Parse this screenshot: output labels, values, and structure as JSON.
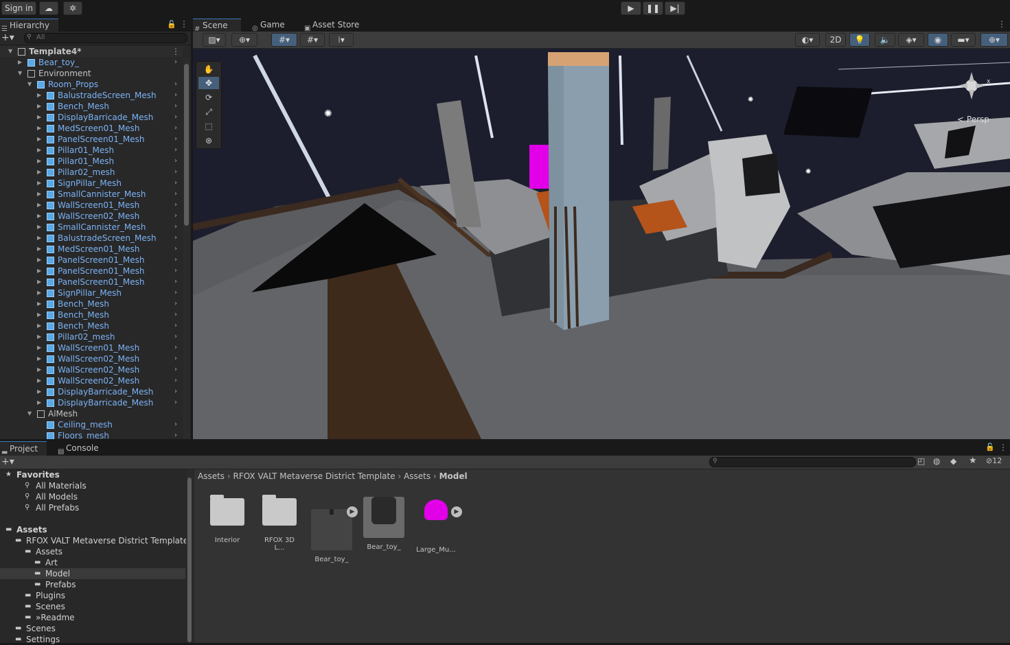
{
  "topbar": {
    "signin": "Sign in"
  },
  "hierarchy": {
    "tab": "Hierarchy",
    "search_placeholder": "All",
    "rows": [
      {
        "label": "Template4*",
        "depth": 0,
        "blue": false
      },
      {
        "label": "Bear_toy_",
        "depth": 1,
        "blue": true
      },
      {
        "label": "Environment",
        "depth": 1,
        "blue": false
      },
      {
        "label": "Room_Props",
        "depth": 2,
        "blue": true
      },
      {
        "label": "BalustradeScreen_Mesh",
        "depth": 3,
        "blue": true
      },
      {
        "label": "Bench_Mesh",
        "depth": 3,
        "blue": true
      },
      {
        "label": "DisplayBarricade_Mesh",
        "depth": 3,
        "blue": true
      },
      {
        "label": "MedScreen01_Mesh",
        "depth": 3,
        "blue": true
      },
      {
        "label": "PanelScreen01_Mesh",
        "depth": 3,
        "blue": true
      },
      {
        "label": "Pillar01_Mesh",
        "depth": 3,
        "blue": true
      },
      {
        "label": "Pillar01_Mesh",
        "depth": 3,
        "blue": true
      },
      {
        "label": "Pillar02_mesh",
        "depth": 3,
        "blue": true
      },
      {
        "label": "SignPillar_Mesh",
        "depth": 3,
        "blue": true
      },
      {
        "label": "SmallCannister_Mesh",
        "depth": 3,
        "blue": true
      },
      {
        "label": "WallScreen01_Mesh",
        "depth": 3,
        "blue": true
      },
      {
        "label": "WallScreen02_Mesh",
        "depth": 3,
        "blue": true
      },
      {
        "label": "SmallCannister_Mesh",
        "depth": 3,
        "blue": true
      },
      {
        "label": "BalustradeScreen_Mesh",
        "depth": 3,
        "blue": true
      },
      {
        "label": "MedScreen01_Mesh",
        "depth": 3,
        "blue": true
      },
      {
        "label": "PanelScreen01_Mesh",
        "depth": 3,
        "blue": true
      },
      {
        "label": "PanelScreen01_Mesh",
        "depth": 3,
        "blue": true
      },
      {
        "label": "PanelScreen01_Mesh",
        "depth": 3,
        "blue": true
      },
      {
        "label": "SignPillar_Mesh",
        "depth": 3,
        "blue": true
      },
      {
        "label": "Bench_Mesh",
        "depth": 3,
        "blue": true
      },
      {
        "label": "Bench_Mesh",
        "depth": 3,
        "blue": true
      },
      {
        "label": "Bench_Mesh",
        "depth": 3,
        "blue": true
      },
      {
        "label": "Pillar02_mesh",
        "depth": 3,
        "blue": true
      },
      {
        "label": "WallScreen01_Mesh",
        "depth": 3,
        "blue": true
      },
      {
        "label": "WallScreen02_Mesh",
        "depth": 3,
        "blue": true
      },
      {
        "label": "WallScreen02_Mesh",
        "depth": 3,
        "blue": true
      },
      {
        "label": "WallScreen02_Mesh",
        "depth": 3,
        "blue": true
      },
      {
        "label": "DisplayBarricade_Mesh",
        "depth": 3,
        "blue": true
      },
      {
        "label": "DisplayBarricade_Mesh",
        "depth": 3,
        "blue": true
      },
      {
        "label": "AlMesh",
        "depth": 2,
        "blue": false
      },
      {
        "label": "Ceiling_mesh",
        "depth": 3,
        "blue": true
      },
      {
        "label": "Floors_mesh",
        "depth": 3,
        "blue": true
      }
    ]
  },
  "scene": {
    "tabs": [
      "Scene",
      "Game",
      "Asset Store"
    ],
    "mode2d": "2D",
    "persp": "Persp"
  },
  "project": {
    "tabs": [
      "Project",
      "Console"
    ],
    "hidden_count": "12",
    "breadcrumb": [
      "Assets",
      "RFOX VALT Metaverse District Template",
      "Assets",
      "Model"
    ],
    "tree": [
      {
        "label": "Favorites",
        "indent": 0,
        "bold": true
      },
      {
        "label": "All Materials",
        "indent": 2
      },
      {
        "label": "All Models",
        "indent": 2
      },
      {
        "label": "All Prefabs",
        "indent": 2
      },
      {
        "label": "",
        "indent": 0
      },
      {
        "label": "Assets",
        "indent": 0,
        "bold": true
      },
      {
        "label": "RFOX VALT Metaverse District Template",
        "indent": 1
      },
      {
        "label": "Assets",
        "indent": 2
      },
      {
        "label": "Art",
        "indent": 3
      },
      {
        "label": "Model",
        "indent": 3,
        "selected": true
      },
      {
        "label": "Prefabs",
        "indent": 3
      },
      {
        "label": "Plugins",
        "indent": 2
      },
      {
        "label": "Scenes",
        "indent": 2
      },
      {
        "label": "»Readme",
        "indent": 2
      },
      {
        "label": "Scenes",
        "indent": 1
      },
      {
        "label": "Settings",
        "indent": 1
      }
    ],
    "items": [
      {
        "label": "Interior",
        "kind": "folder"
      },
      {
        "label": "RFOX 3D L...",
        "kind": "folder"
      },
      {
        "label": "Bear_toy_",
        "kind": "model"
      },
      {
        "label": "Bear_toy_",
        "kind": "prefab"
      },
      {
        "label": "Large_Mu...",
        "kind": "magenta"
      }
    ]
  }
}
